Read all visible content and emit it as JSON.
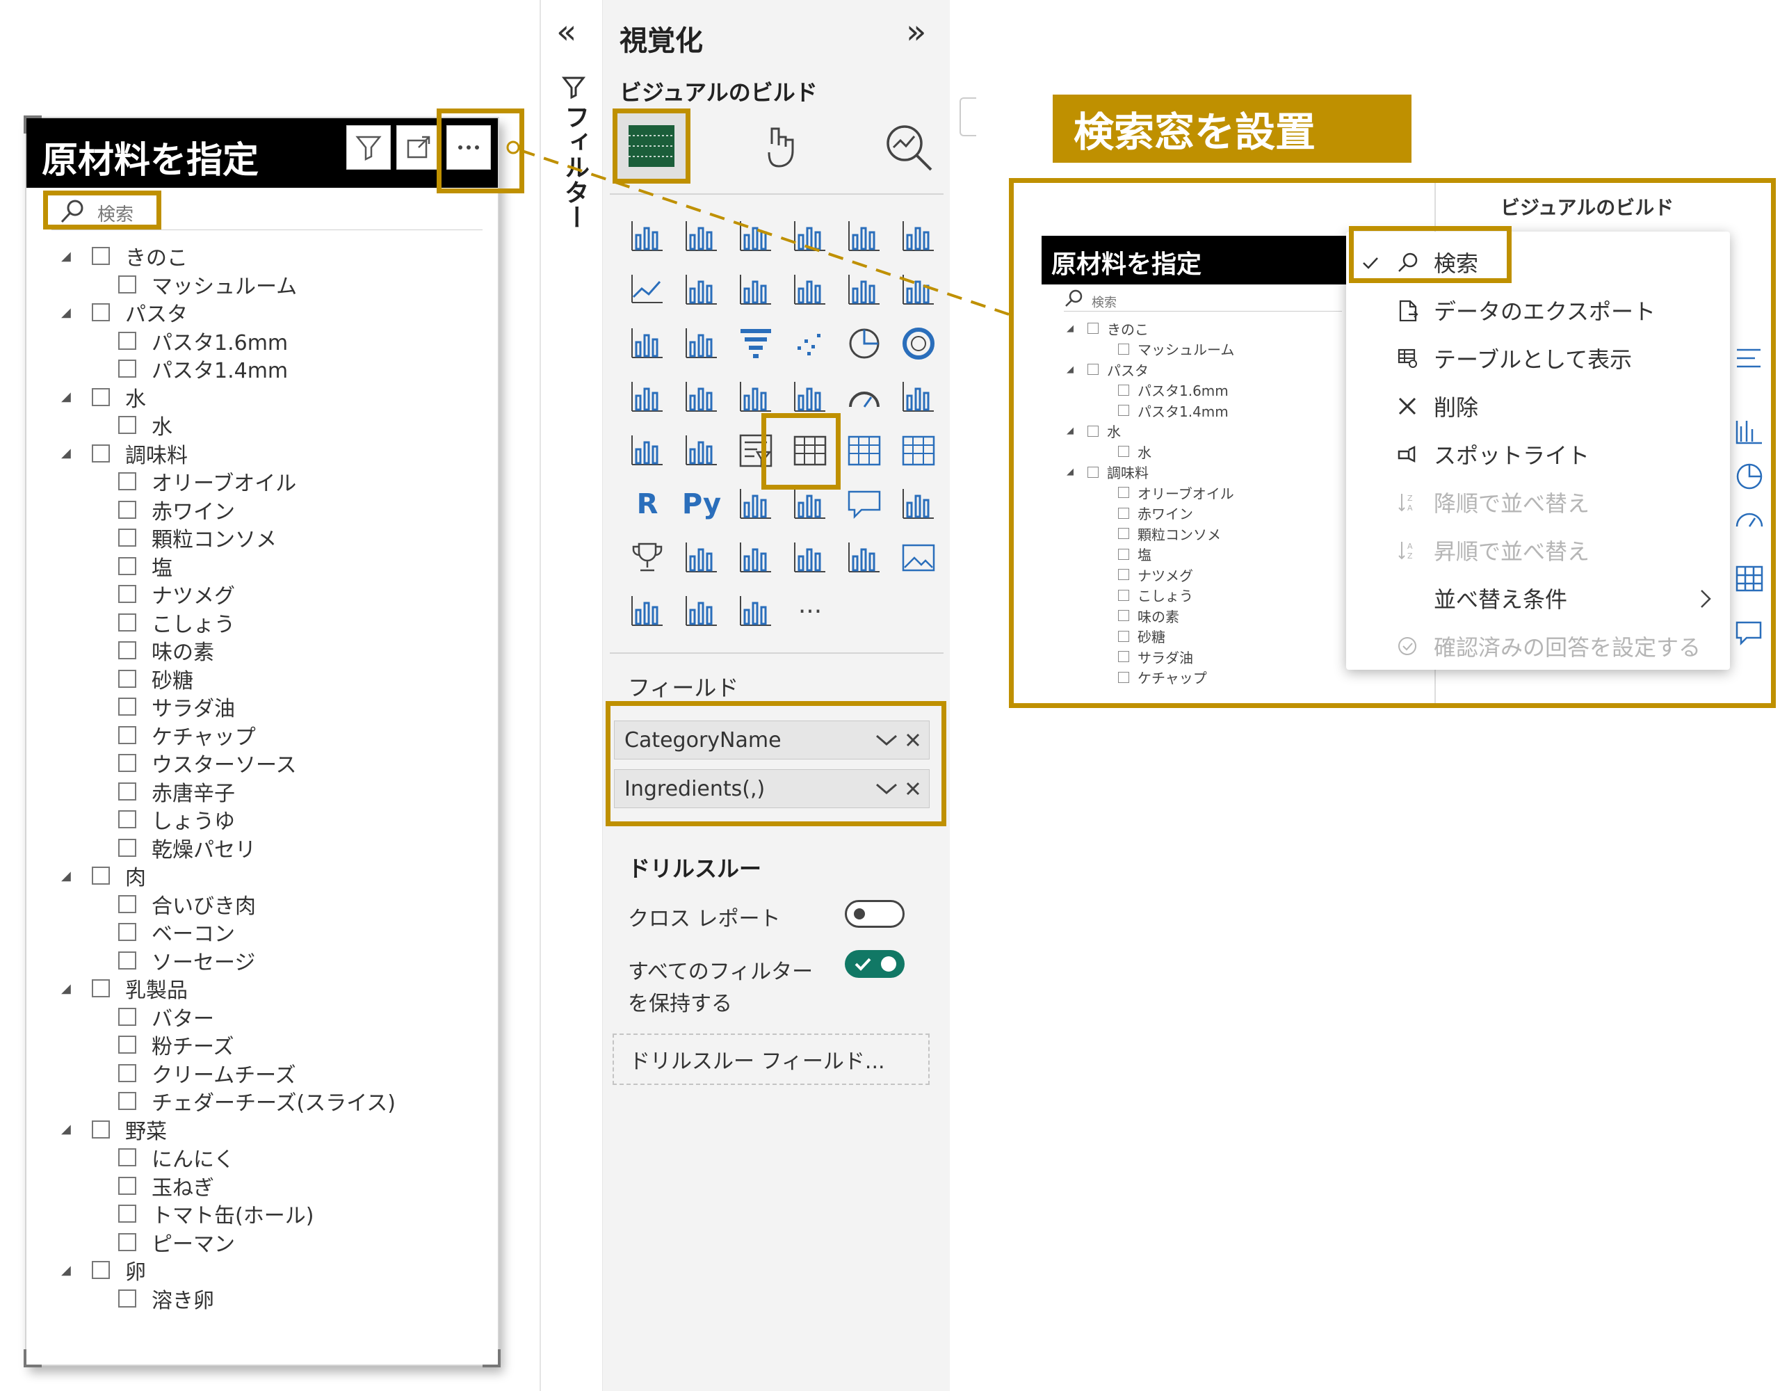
{
  "slicer": {
    "title": "原材料を指定",
    "search_placeholder": "検索",
    "items": [
      {
        "label": "きのこ",
        "level": 0,
        "expander": "◢"
      },
      {
        "label": "マッシュルーム",
        "level": 1
      },
      {
        "label": "パスタ",
        "level": 0,
        "expander": "◢"
      },
      {
        "label": "パスタ1.6mm",
        "level": 1
      },
      {
        "label": "パスタ1.4mm",
        "level": 1
      },
      {
        "label": "水",
        "level": 0,
        "expander": "◢"
      },
      {
        "label": "水",
        "level": 1
      },
      {
        "label": "調味料",
        "level": 0,
        "expander": "◢"
      },
      {
        "label": "オリーブオイル",
        "level": 1
      },
      {
        "label": "赤ワイン",
        "level": 1
      },
      {
        "label": "顆粒コンソメ",
        "level": 1
      },
      {
        "label": "塩",
        "level": 1
      },
      {
        "label": "ナツメグ",
        "level": 1
      },
      {
        "label": "こしょう",
        "level": 1
      },
      {
        "label": "味の素",
        "level": 1
      },
      {
        "label": "砂糖",
        "level": 1
      },
      {
        "label": "サラダ油",
        "level": 1
      },
      {
        "label": "ケチャップ",
        "level": 1
      },
      {
        "label": "ウスターソース",
        "level": 1
      },
      {
        "label": "赤唐辛子",
        "level": 1
      },
      {
        "label": "しょうゆ",
        "level": 1
      },
      {
        "label": "乾燥パセリ",
        "level": 1
      },
      {
        "label": "肉",
        "level": 0,
        "expander": "◢"
      },
      {
        "label": "合いびき肉",
        "level": 1
      },
      {
        "label": "ベーコン",
        "level": 1
      },
      {
        "label": "ソーセージ",
        "level": 1
      },
      {
        "label": "乳製品",
        "level": 0,
        "expander": "◢"
      },
      {
        "label": "バター",
        "level": 1
      },
      {
        "label": "粉チーズ",
        "level": 1
      },
      {
        "label": "クリームチーズ",
        "level": 1
      },
      {
        "label": "チェダーチーズ(スライス)",
        "level": 1
      },
      {
        "label": "野菜",
        "level": 0,
        "expander": "◢"
      },
      {
        "label": "にんにく",
        "level": 1
      },
      {
        "label": "玉ねぎ",
        "level": 1
      },
      {
        "label": "トマト缶(ホール)",
        "level": 1
      },
      {
        "label": "ピーマン",
        "level": 1
      },
      {
        "label": "卵",
        "level": 0,
        "expander": "◢"
      },
      {
        "label": "溶き卵",
        "level": 1
      }
    ]
  },
  "filter_rail": {
    "collapse_glyph": "«",
    "label": "フィルター"
  },
  "viz_pane": {
    "title": "視覚化",
    "expand_glyph": "»",
    "build_label": "ビジュアルのビルド",
    "fields_label": "フィールド",
    "fields": [
      {
        "name": "CategoryName"
      },
      {
        "name": "Ingredients(,)"
      }
    ],
    "drillthrough": {
      "heading": "ドリルスルー",
      "cross_report": "クロス レポート",
      "keep_filters": "すべてのフィルター",
      "keep_filters_line2": "を保持する",
      "drop_zone": "ドリルスルー フィールド..."
    },
    "more_visuals": "···",
    "r_label": "R",
    "py_label": "Py"
  },
  "callout": {
    "label": "検索窓を設置",
    "slicer_title": "原材料を指定",
    "search_placeholder": "検索",
    "mini_items": [
      "きのこ",
      "マッシュルーム",
      "パスタ",
      "パスタ1.6mm",
      "パスタ1.4mm",
      "水",
      "水",
      "調味料",
      "オリーブオイル",
      "赤ワイン",
      "顆粒コンソメ",
      "塩",
      "ナツメグ",
      "こしょう",
      "味の素",
      "砂糖",
      "サラダ油",
      "ケチャップ"
    ],
    "bg_text": "ビジュアルのビルド",
    "menu": [
      {
        "label": "検索",
        "icon": "search-icon",
        "checked": true,
        "disabled": false
      },
      {
        "label": "データのエクスポート",
        "icon": "export-icon",
        "disabled": false
      },
      {
        "label": "テーブルとして表示",
        "icon": "table-view-icon",
        "disabled": false
      },
      {
        "label": "削除",
        "icon": "close-icon",
        "disabled": false
      },
      {
        "label": "スポットライト",
        "icon": "spotlight-icon",
        "disabled": false
      },
      {
        "label": "降順で並べ替え",
        "icon": "sort-desc-icon",
        "disabled": true
      },
      {
        "label": "昇順で並べ替え",
        "icon": "sort-asc-icon",
        "disabled": true
      },
      {
        "label": "並べ替え条件",
        "icon": "",
        "disabled": false,
        "submenu": true
      },
      {
        "label": "確認済みの回答を設定する",
        "icon": "verified-icon",
        "disabled": true
      }
    ]
  },
  "colors": {
    "highlight": "#bf9000",
    "toggle_on": "#117865",
    "header": "#000000"
  }
}
